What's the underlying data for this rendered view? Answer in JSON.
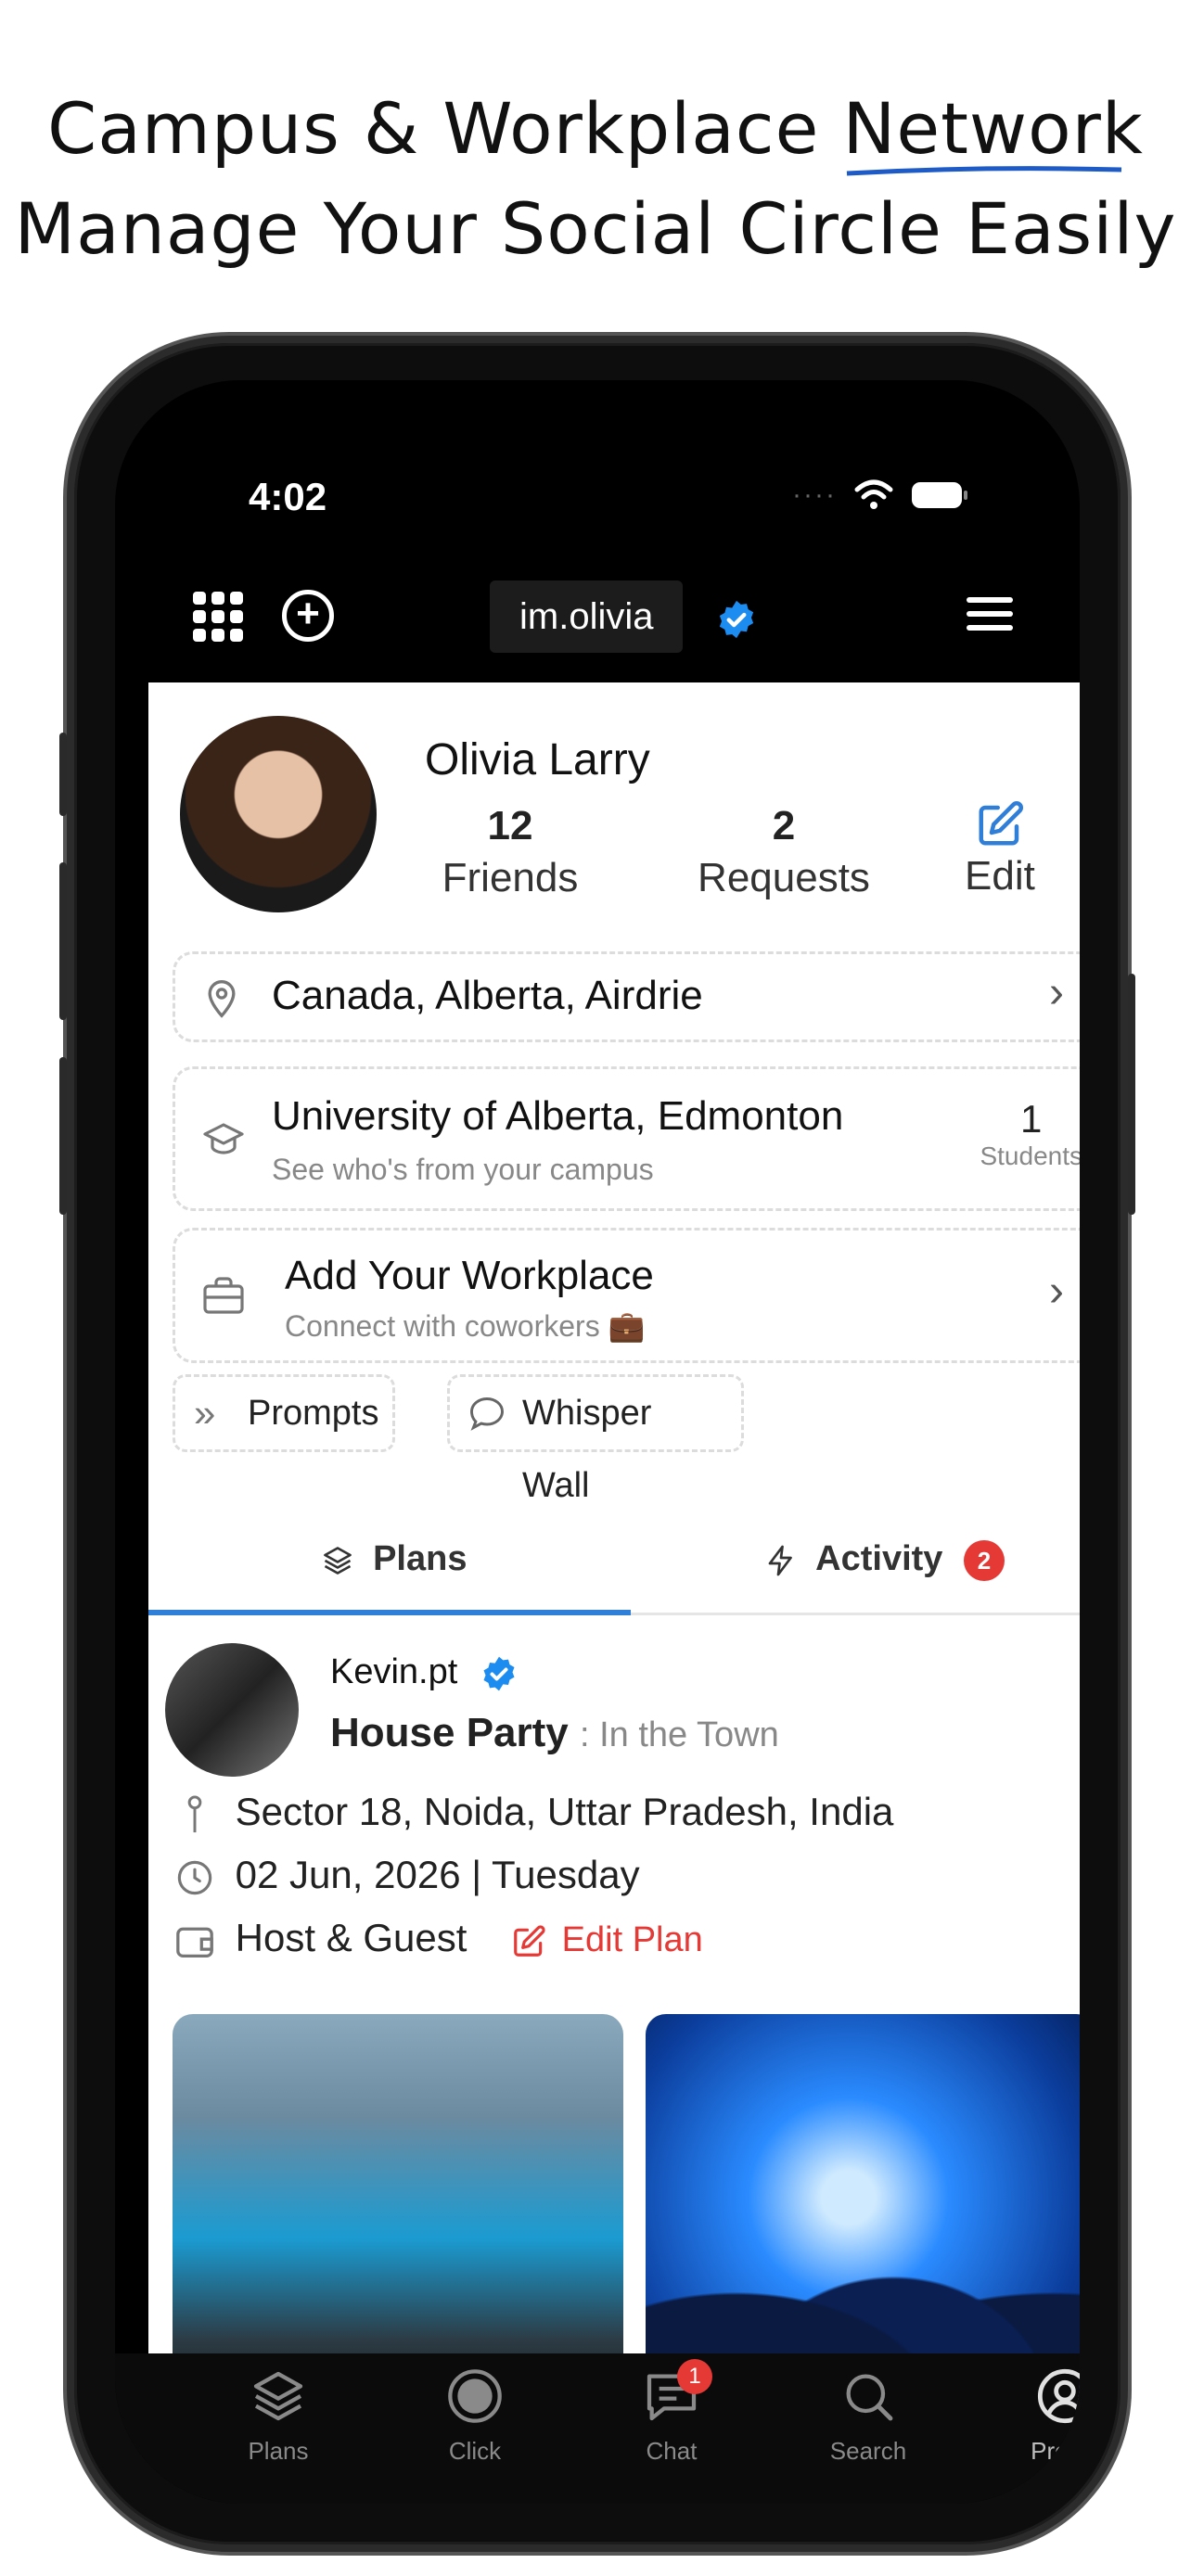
{
  "headline": {
    "line1_prefix": "Campus & Workplace",
    "line1_highlight": "Network",
    "line2": "Manage Your Social Circle Easily"
  },
  "status_bar": {
    "time": "4:02"
  },
  "top_bar": {
    "username": "im.olivia"
  },
  "profile": {
    "name": "Olivia Larry",
    "friends_count": "12",
    "friends_label": "Friends",
    "requests_count": "2",
    "requests_label": "Requests",
    "edit_label": "Edit"
  },
  "location": {
    "text": "Canada, Alberta, Airdrie"
  },
  "campus": {
    "title": "University of Alberta, Edmonton",
    "subtitle": "See who's from your campus",
    "students_count": "1",
    "students_label": "Students"
  },
  "workplace": {
    "title": "Add Your Workplace",
    "subtitle": "Connect with coworkers 💼"
  },
  "chips": {
    "prompts": "Prompts",
    "whisper_wall": "Whisper Wall"
  },
  "tabs": {
    "plans": "Plans",
    "activity": "Activity",
    "activity_badge": "2"
  },
  "post": {
    "username": "Kevin.pt",
    "title": "House Party",
    "subtitle": ": In the Town",
    "location": "Sector 18, Noida, Uttar Pradesh, India",
    "date": "02 Jun, 2026 | Tuesday",
    "role": "Host & Guest",
    "edit_plan": "Edit Plan"
  },
  "bottom_nav": {
    "plans": "Plans",
    "click": "Click",
    "chat": "Chat",
    "chat_badge": "1",
    "search": "Search",
    "profile": "Profile"
  },
  "colors": {
    "accent_blue": "#2f7fd8",
    "badge_red": "#e53935",
    "verified_blue": "#1d8cf0"
  }
}
